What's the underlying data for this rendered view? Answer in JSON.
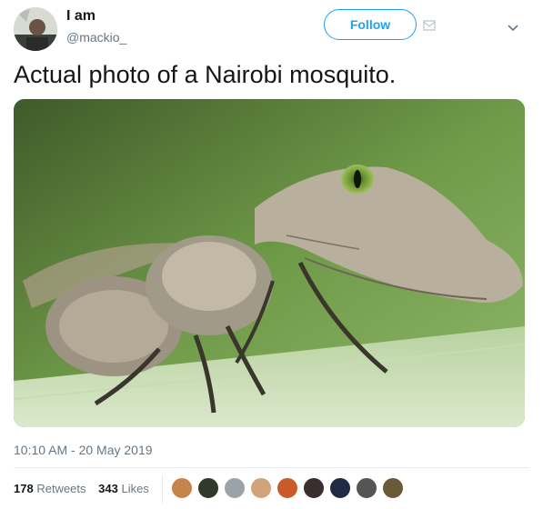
{
  "tweet": {
    "display_name": "I am",
    "handle": "@mackio_",
    "follow_label": "Follow",
    "text": "Actual photo of a Nairobi mosquito.",
    "timestamp": "10:10 AM - 20 May 2019"
  },
  "stats": {
    "retweets_count": "178",
    "retweets_label": "Retweets",
    "likes_count": "343",
    "likes_label": "Likes"
  },
  "likers": [
    {
      "color": "#c7844a"
    },
    {
      "color": "#2f3a2a"
    },
    {
      "color": "#9aa4a8"
    },
    {
      "color": "#d1a37a"
    },
    {
      "color": "#c95a2a"
    },
    {
      "color": "#3a2f2f"
    },
    {
      "color": "#1f2a44"
    },
    {
      "color": "#555555"
    },
    {
      "color": "#6b5a3a"
    }
  ],
  "colors": {
    "brand": "#1da1f2",
    "text_primary": "#14171a",
    "text_secondary": "#657786",
    "divider": "#e6ecf0"
  },
  "icons": {
    "dm": "envelope-icon",
    "more": "chevron-down-icon"
  }
}
